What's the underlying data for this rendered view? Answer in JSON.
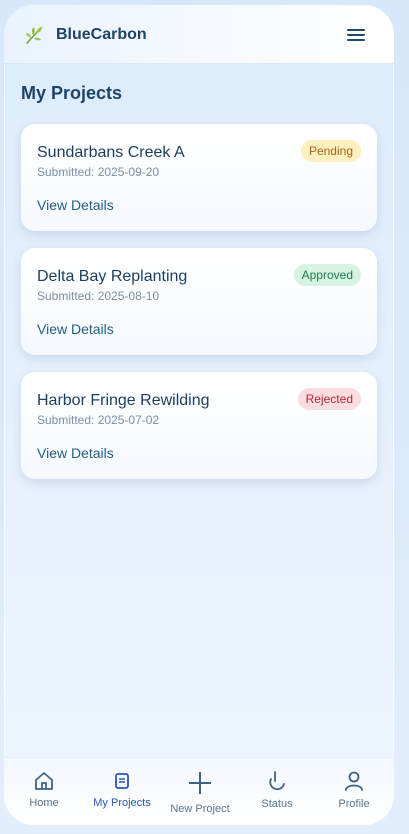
{
  "header": {
    "brand": "BlueCarbon",
    "logo_icon": "leaf-icon",
    "menu_icon": "hamburger-menu-icon"
  },
  "page": {
    "title": "My Projects"
  },
  "projects": [
    {
      "title": "Sundarbans Creek A",
      "submitted": "Submitted: 2025-09-20",
      "status": "Pending",
      "link": "View Details"
    },
    {
      "title": "Delta Bay Replanting",
      "submitted": "Submitted: 2025-08-10",
      "status": "Approved",
      "link": "View Details"
    },
    {
      "title": "Harbor Fringe Rewilding",
      "submitted": "Submitted: 2025-07-02",
      "status": "Rejected",
      "link": "View Details"
    }
  ],
  "nav": {
    "active": "My Projects",
    "items": [
      {
        "label": "Home",
        "icon": "home-icon"
      },
      {
        "label": "My Projects",
        "icon": "document-icon"
      },
      {
        "label": "New Project",
        "icon": "plus-icon"
      },
      {
        "label": "Status",
        "icon": "status-icon"
      },
      {
        "label": "Profile",
        "icon": "user-icon"
      }
    ]
  },
  "colors": {
    "accent": "#2a55b8",
    "title": "#1c4466",
    "pending": "#fdefbe",
    "approved": "#d7f3e3",
    "rejected": "#fbdde1"
  }
}
